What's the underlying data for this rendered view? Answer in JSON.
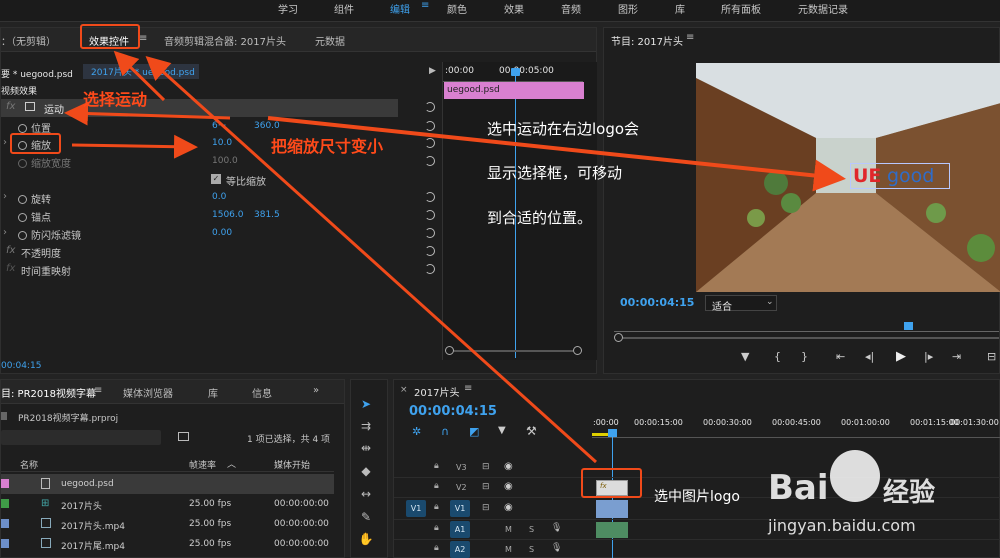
{
  "menu": {
    "items": [
      "学习",
      "组件",
      "编辑",
      "颜色",
      "效果",
      "音频",
      "图形",
      "库",
      "所有面板",
      "元数据记录"
    ],
    "active_label": "编辑"
  },
  "effect_panel": {
    "tab_source": "：（无剪辑）",
    "tab_effects": "效果控件",
    "tab_mixer": "音频剪辑混合器: 2017片头",
    "tab_metadata": "元数据",
    "clip_master": "要 * uegood.psd",
    "clip_seq": "2017片头 * uegood.psd",
    "section": "视频效果",
    "timecode_start": ":00:00",
    "timecode_mid": "00:00:05:00",
    "clip_bar_label": "uegood.psd",
    "motion_label": "运动",
    "position_label": "位置",
    "position_x": "6···",
    "position_y": "360.0",
    "scale_label": "缩放",
    "scale_value": "10.0",
    "scale_width_label": "缩放宽度",
    "scale_width_value": "100.0",
    "uniform_label": "等比缩放",
    "rotation_label": "旋转",
    "rotation_value": "0.0",
    "anchor_label": "锚点",
    "anchor_x": "1506.0",
    "anchor_y": "381.5",
    "flicker_label": "防闪烁滤镜",
    "flicker_value": "0.00",
    "opacity_label": "不透明度",
    "remap_label": "时间重映射",
    "fx": "fx",
    "timecode_bottom": "00:04:15"
  },
  "program": {
    "title": "节目: 2017片头",
    "timecode": "00:00:04:15",
    "fit": "适合",
    "logo_ue": "UE",
    "logo_good": "good"
  },
  "project": {
    "tab_project": "目: PR2018视频字幕",
    "tab_media": "媒体浏览器",
    "tab_lib": "库",
    "tab_info": "信息",
    "file": "PR2018视频字幕.prproj",
    "selection_info": "1 项已选择，共 4 项",
    "col_name": "名称",
    "col_fps": "帧速率",
    "col_start": "媒体开始",
    "rows": [
      {
        "name": "uegood.psd",
        "fps": "",
        "start": ""
      },
      {
        "name": "2017片头",
        "fps": "25.00 fps",
        "start": "00:00:00:00"
      },
      {
        "name": "2017片头.mp4",
        "fps": "25.00 fps",
        "start": "00:00:00:00"
      },
      {
        "name": "2017片尾.mp4",
        "fps": "25.00 fps",
        "start": "00:00:00:00"
      }
    ]
  },
  "timeline": {
    "title": "2017片头",
    "timecode": "00:00:04:15",
    "ruler": [
      ":00:00",
      "00:00:15:00",
      "00:00:30:00",
      "00:00:45:00",
      "00:01:00:00",
      "00:01:15:00",
      "00:01:30:00"
    ],
    "tracks": [
      "V3",
      "V2",
      "V1",
      "A1",
      "A2"
    ],
    "src_v1": "V1",
    "src_a1": "A1",
    "m": "M",
    "s": "S",
    "fx": "fx"
  },
  "annotations": {
    "select_motion": "选择运动",
    "shrink_scale": "把缩放尺寸变小",
    "right_l1": "选中运动在右边logo会",
    "right_l2": "显示选择框，可移动",
    "right_l3": "到合适的位置。",
    "select_logo": "选中图片logo"
  },
  "watermark": {
    "brand": "Bai",
    "brand2": "经验",
    "url": "jingyan.baidu.com"
  },
  "colors": {
    "accent_blue": "#3fa2ee",
    "annotation_red": "#f04a1a",
    "clip_pink": "#d980d0"
  }
}
